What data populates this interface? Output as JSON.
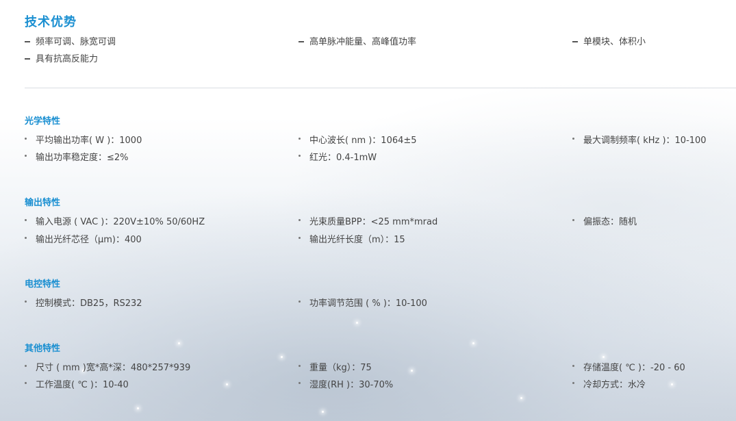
{
  "header": {
    "title": "技术优势"
  },
  "advantages": [
    "频率可调、脉宽可调",
    "高单脉冲能量、高峰值功率",
    "单模块、体积小",
    "具有抗高反能力"
  ],
  "sections": {
    "optical": {
      "title": "光学特性",
      "items": [
        "平均输出功率( W )：1000",
        "中心波长( nm )：1064±5",
        "最大调制频率( kHz )：10-100",
        "输出功率稳定度：≤2%",
        "红光：0.4-1mW"
      ]
    },
    "output": {
      "title": "输出特性",
      "items": [
        "输入电源 ( VAC )：220V±10% 50/60HZ",
        "光束质量BPP：<25 mm*mrad",
        "偏振态：随机",
        "输出光纤芯径（μm)：400",
        "输出光纤长度（m）：15"
      ]
    },
    "electrical": {
      "title": "电控特性",
      "items": [
        "控制模式：DB25，RS232",
        "功率调节范围 ( % )：10-100"
      ]
    },
    "other": {
      "title": "其他特性",
      "items": [
        "尺寸 ( mm )宽*高*深：480*257*939",
        "重量（kg）：75",
        "存储温度( ℃ )：-20 - 60",
        "工作温度( ℃ )：10-40",
        "湿度(RH )：30-70%",
        "冷却方式：水冷"
      ]
    }
  },
  "colors": {
    "accent": "#1a8fd1",
    "text": "#444444",
    "divider": "#d9dde2"
  }
}
